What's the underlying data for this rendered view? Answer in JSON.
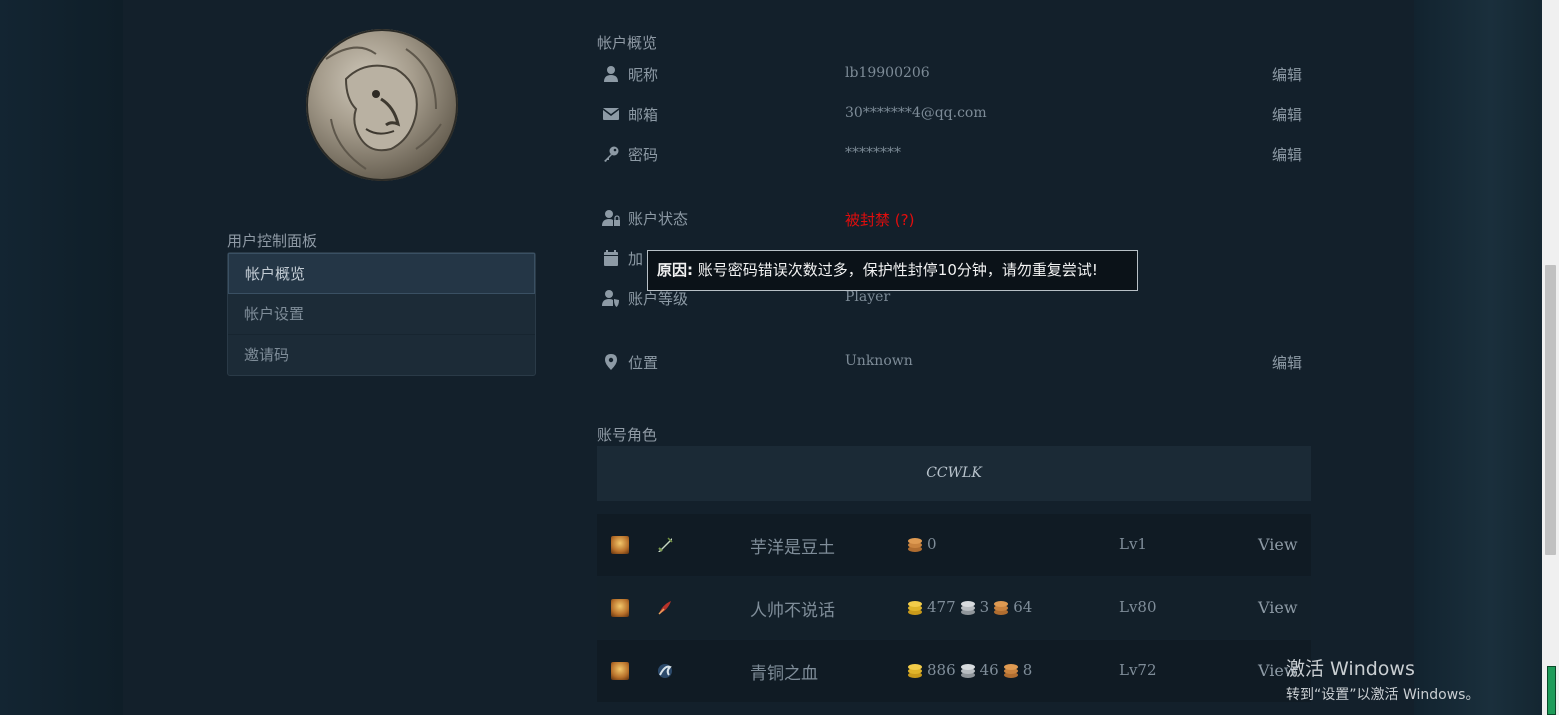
{
  "sidebar": {
    "title": "用户控制面板",
    "items": [
      {
        "label": "帐户概览"
      },
      {
        "label": "帐户设置"
      },
      {
        "label": "邀请码"
      }
    ]
  },
  "overview": {
    "title": "帐户概览",
    "nickname": {
      "label": "昵称",
      "value": "lb19900206",
      "action": "编辑"
    },
    "email": {
      "label": "邮箱",
      "value": "30*******4@qq.com",
      "action": "编辑"
    },
    "password": {
      "label": "密码",
      "value": "********",
      "action": "编辑"
    },
    "status": {
      "label": "账户状态",
      "value": "被封禁 (?)"
    },
    "joined": {
      "label": "加"
    },
    "level": {
      "label": "账户等级",
      "value": "Player"
    },
    "location": {
      "label": "位置",
      "value": "Unknown",
      "action": "编辑"
    }
  },
  "tooltip": {
    "prefix": "原因:",
    "text": " 账号密码错误次数过多，保护性封停10分钟，请勿重复尝试!"
  },
  "characters": {
    "title": "账号角色",
    "realm": "CCWLK",
    "rows": [
      {
        "name": "芋洋是豆土",
        "gold": "0",
        "silver": "",
        "copper": "",
        "level": "Lv1",
        "action": "View"
      },
      {
        "name": "人帅不说话",
        "gold": "477",
        "silver": "3",
        "copper": "64",
        "level": "Lv80",
        "action": "View"
      },
      {
        "name": "青铜之血",
        "gold": "886",
        "silver": "46",
        "copper": "8",
        "level": "Lv72",
        "action": "View"
      }
    ]
  },
  "watermark": {
    "line1": "激活 Windows",
    "line2": "转到“设置”以激活 Windows。"
  }
}
